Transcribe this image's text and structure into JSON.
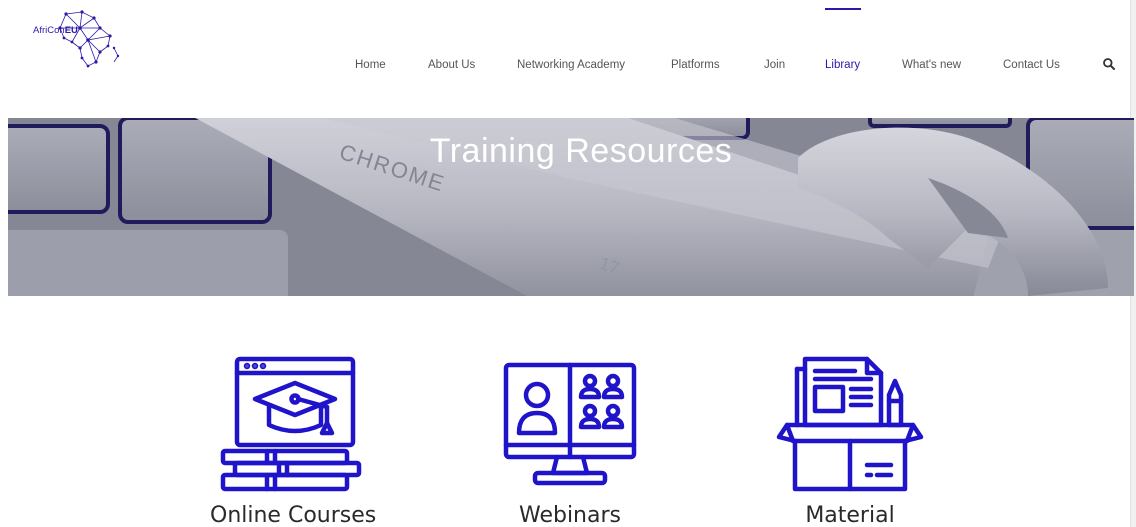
{
  "brand": {
    "logo_prefix": "AfriCon",
    "logo_suffix": "EU",
    "accent_color": "#2b1aa8"
  },
  "nav": {
    "items": [
      {
        "label": "Home"
      },
      {
        "label": "About Us"
      },
      {
        "label": "Networking Academy"
      },
      {
        "label": "Platforms"
      },
      {
        "label": "Join"
      },
      {
        "label": "Library"
      },
      {
        "label": "What's new"
      },
      {
        "label": "Contact Us"
      }
    ],
    "active": "Library",
    "search_icon": "search-icon"
  },
  "hero": {
    "title": "Training Resources"
  },
  "categories": [
    {
      "label": "Online Courses",
      "icon": "online-courses-icon"
    },
    {
      "label": "Webinars",
      "icon": "webinars-icon"
    },
    {
      "label": "Material",
      "icon": "material-icon"
    }
  ]
}
